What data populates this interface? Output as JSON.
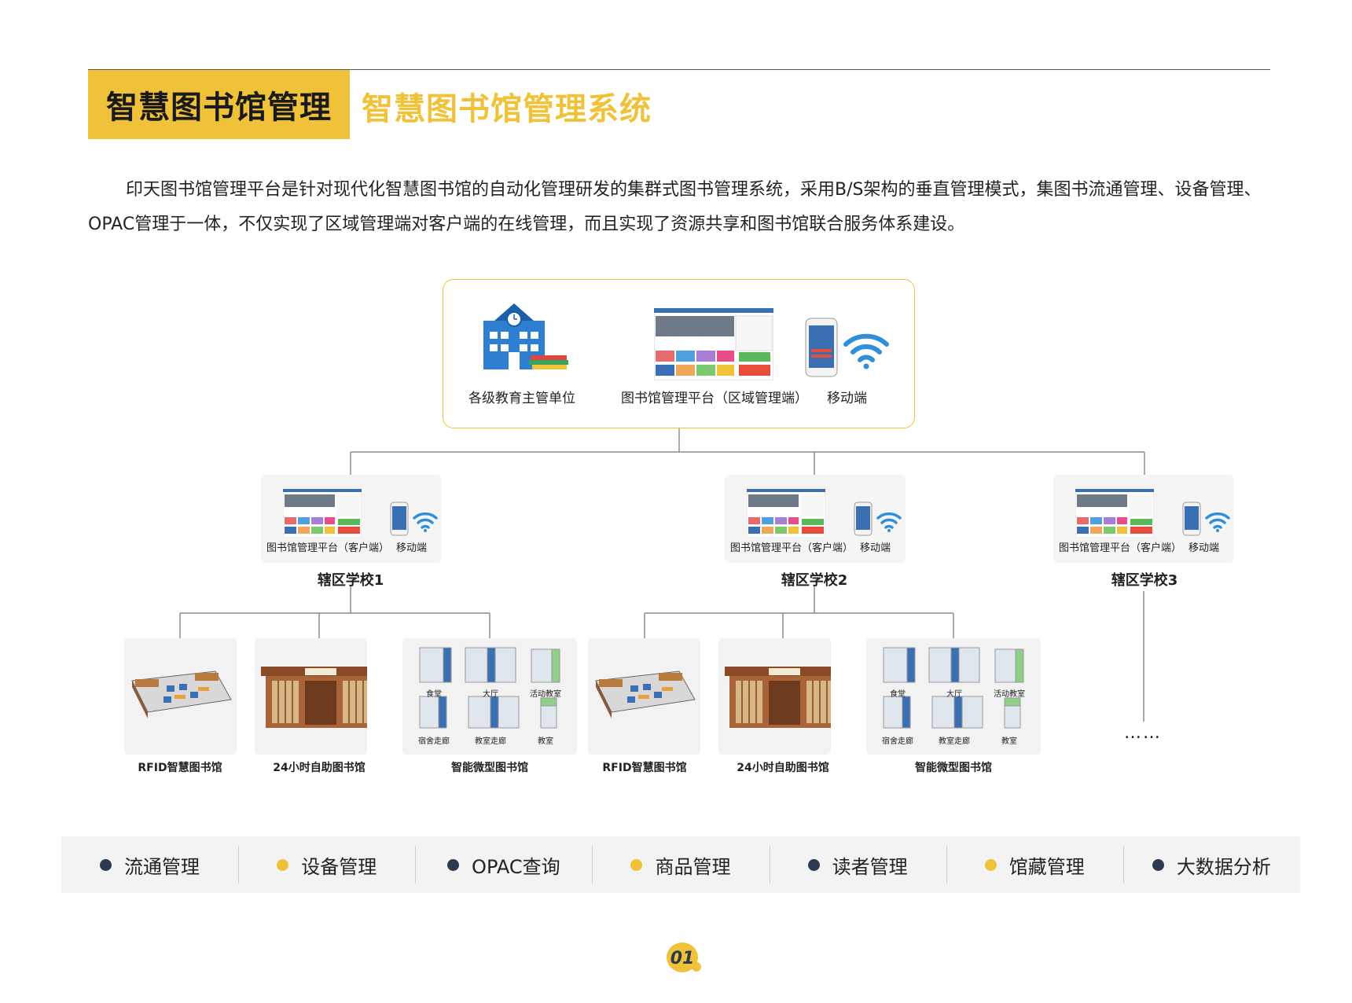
{
  "header": {
    "title": "智慧图书馆管理",
    "subtitle": "智慧图书馆管理系统"
  },
  "intro": "印天图书馆管理平台是针对现代化智慧图书馆的自动化管理研发的集群式图书管理系统，采用B/S架构的垂直管理模式，集图书流通管理、设备管理、OPAC管理于一体，不仅实现了区域管理端对客户端的在线管理，而且实现了资源共享和图书馆联合服务体系建设。",
  "top_node": {
    "education_label": "各级教育主管单位",
    "platform_label": "图书馆管理平台（区域管理端）",
    "mobile_label": "移动端"
  },
  "schools": [
    {
      "name": "辖区学校1",
      "platform_label": "图书馆管理平台（客户端）",
      "mobile_label": "移动端"
    },
    {
      "name": "辖区学校2",
      "platform_label": "图书馆管理平台（客户端）",
      "mobile_label": "移动端"
    },
    {
      "name": "辖区学校3",
      "platform_label": "图书馆管理平台（客户端）",
      "mobile_label": "移动端"
    }
  ],
  "library_types": {
    "rfid": "RFID智慧图书馆",
    "selfservice": "24小时自助图书馆",
    "micro": "智能微型图书馆"
  },
  "micro_locations": [
    "食堂",
    "大厅",
    "活动教室",
    "宿舍走廊",
    "教室走廊",
    "教室"
  ],
  "ellipsis": "……",
  "features": [
    {
      "label": "流通管理",
      "dot_color": "#2b3a4e"
    },
    {
      "label": "设备管理",
      "dot_color": "#f0c23a"
    },
    {
      "label": "OPAC查询",
      "dot_color": "#2b3a4e"
    },
    {
      "label": "商品管理",
      "dot_color": "#f0c23a"
    },
    {
      "label": "读者管理",
      "dot_color": "#2b3a4e"
    },
    {
      "label": "馆藏管理",
      "dot_color": "#f0c23a"
    },
    {
      "label": "大数据分析",
      "dot_color": "#2b3a4e"
    }
  ],
  "page_number": "01",
  "colors": {
    "accent": "#f0c23a",
    "dark": "#2b3a4e",
    "brand_blue": "#2f7fd0"
  }
}
